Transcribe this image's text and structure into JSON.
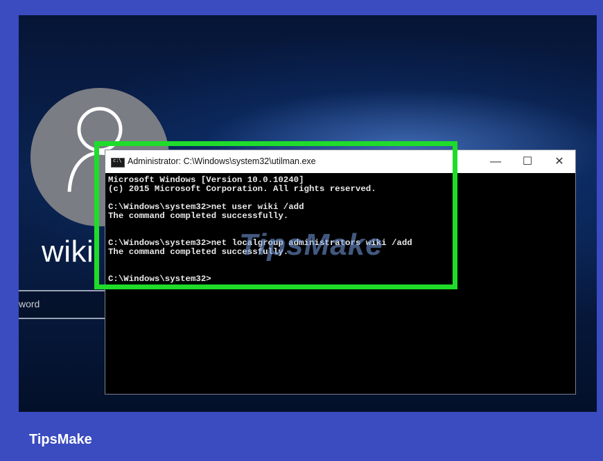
{
  "login": {
    "username": "wiki",
    "password_placeholder": "word"
  },
  "cmd_window": {
    "title": "Administrator: C:\\Windows\\system32\\utilman.exe",
    "minimize_glyph": "—",
    "maximize_glyph": "☐",
    "close_glyph": "✕",
    "lines": [
      "Microsoft Windows [Version 10.0.10240]",
      "(c) 2015 Microsoft Corporation. All rights reserved.",
      "",
      "C:\\Windows\\system32>net user wiki /add",
      "The command completed successfully.",
      "",
      "",
      "C:\\Windows\\system32>net localgroup administrators wiki /add",
      "The command completed successfully.",
      "",
      "",
      "C:\\Windows\\system32>"
    ]
  },
  "watermark": "TipsMake",
  "brand": "TipsMake",
  "colors": {
    "highlight": "#1fdc2b",
    "frame": "#3b4bc0"
  }
}
